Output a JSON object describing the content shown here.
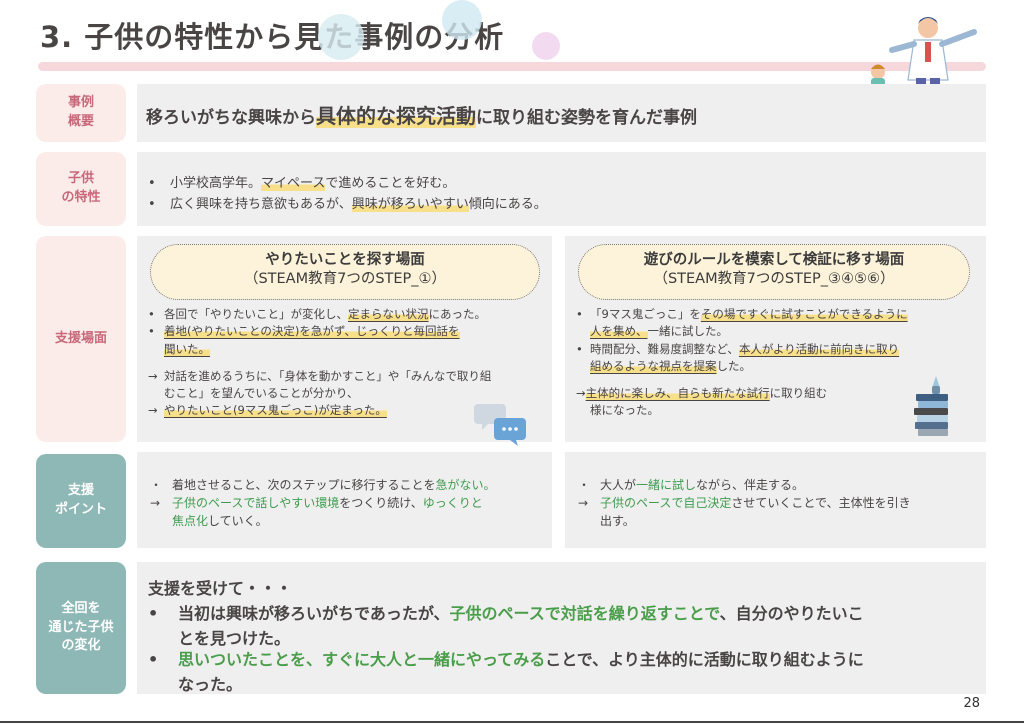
{
  "title": "3. 子供の特性から見た事例の分析",
  "page_number": "28",
  "labels": {
    "summary": "事例\n概要",
    "traits": "子供\nの特性",
    "scene": "支援場面",
    "points": "支援\nポイント",
    "change": "全回を\n通じた子供\nの変化"
  },
  "summary": {
    "pre": "移ろいがちな興味から",
    "highlight": "具体的な探究活動",
    "post": "に取り組む姿勢を育んだ事例"
  },
  "traits": [
    {
      "bullet": "•",
      "a": "小学校高学年。",
      "hl": "マイペース",
      "b": "で進めることを好む。"
    },
    {
      "bullet": "•",
      "a": "広く興味を持ち意欲もあるが、",
      "hl": "興味が移ろいやすい",
      "b": "傾向にある。"
    }
  ],
  "scene_left": {
    "pill_title": "やりたいことを探す場面",
    "pill_sub": "（STEAM教育7つのSTEP_①）",
    "b1_a": "各回で「やりたいこと」が変化し、",
    "b1_hl": "定まらない状況",
    "b1_b": "にあった。",
    "b2_l1": "着地(やりたいことの決定)を急がず、じっくりと毎回話を",
    "b2_l2": "聞いた。",
    "arrow1": "→",
    "a1_l1": "対話を進めるうちに、「身体を動かすこと」や「みんなで取り組",
    "a1_l2": "むこと」を望んでいることが分かり、",
    "a2_hl": "やりたいこと(9マス鬼ごっこ)が定まった。",
    "bullet": "•"
  },
  "scene_right": {
    "pill_title": "遊びのルールを模索して検証に移す場面",
    "pill_sub": "（STEAM教育7つのSTEP_③④⑤⑥）",
    "b1_a": "「9マス鬼ごっこ」を",
    "b1_hl1": "その場ですぐに試すことができるように",
    "b1_hl2": "人を集め、",
    "b1_b": "一緒に試した。",
    "b2_a": "時間配分、難易度調整など、",
    "b2_hl1": "本人がより活動に前向きに取り",
    "b2_hl2": "組めるような視点を提案",
    "b2_b": "した。",
    "arrow": "→",
    "a_hl": "主体的に楽しみ、自らも新たな試行",
    "a_b": "に取り組む",
    "a_l2": "様になった。",
    "bullet": "•"
  },
  "points_left": {
    "r1_mk": "・",
    "r1_a": "着地させること、次のステップに移行することを",
    "r1_g": "急がない。",
    "r2_mk": "→",
    "r2_g1": "子供のペースで話しやすい環境",
    "r2_a": "をつくり続け、",
    "r2_g2": "ゆっくりと",
    "r3_g": "焦点化",
    "r3_a": "していく。"
  },
  "points_right": {
    "r1_mk": "・",
    "r1_a": "大人が",
    "r1_g": "一緒に試し",
    "r1_b": "ながら、伴走する。",
    "r2_mk": "→",
    "r2_g": "子供のペースで自己決定",
    "r2_a": "させていくことで、主体性を引き",
    "r3_a": "出す。"
  },
  "change": {
    "head": "支援を受けて・・・",
    "bullet": "•",
    "c1_a": "当初は興味が移ろいがちであったが、",
    "c1_g": "子供のペースで対話を繰り返すことで",
    "c1_b": "、自分のやりたいこ",
    "c1_l2": "とを見つけた。",
    "c2_g": "思いついたことを、すぐに大人と一緒にやってみる",
    "c2_b": "ことで、より主体的に活動に取り組むように",
    "c2_l2": "なった。"
  },
  "colors": {
    "pink_label": "#fbece9",
    "teal_label": "#8db8b6",
    "panel": "#efefef",
    "highlight": "#f8e08a",
    "green": "#4a9e4a",
    "title_bar": "#f6d7dc"
  }
}
